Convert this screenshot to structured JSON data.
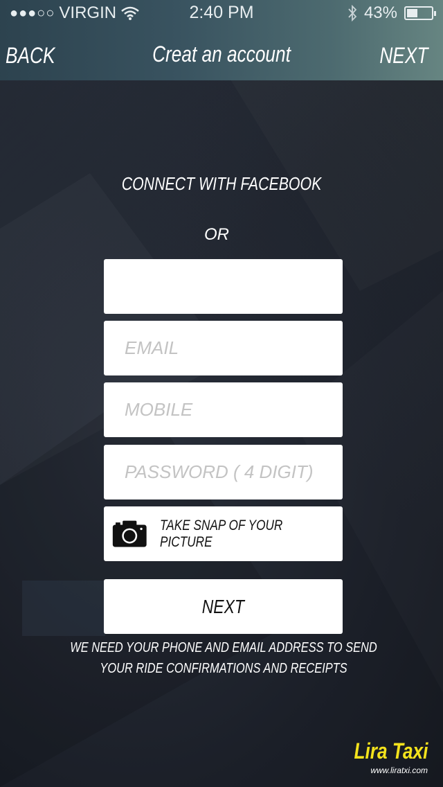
{
  "status_bar": {
    "signal": "●●●○○",
    "carrier": "VIRGIN",
    "time": "2:40 PM",
    "battery": "43%",
    "battery_level": 0.43
  },
  "nav": {
    "back": "BACK",
    "title": "Creat an account",
    "next": "NEXT"
  },
  "facebook": "CONNECT WITH FACEBOOK",
  "or": "OR",
  "form": {
    "name_value": "",
    "email_placeholder": "EMAIL",
    "mobile_placeholder": "MOBILE",
    "password_placeholder": "PASSWORD ( 4 DIGIT)",
    "snap_label": "TAKE SNAP OF YOUR PICTURE",
    "next_button": "NEXT"
  },
  "note_line1": "WE NEED YOUR PHONE AND EMAIL ADDRESS TO  SEND",
  "note_line2": "YOUR  RIDE CONFIRMATIONS AND RECEIPTS",
  "brand": {
    "name": "Lira Taxi",
    "url": "www.liratxi.com"
  },
  "icons": {
    "wifi": "wifi-icon",
    "bluetooth": "bluetooth-icon",
    "battery": "battery-icon",
    "camera": "camera-icon"
  }
}
